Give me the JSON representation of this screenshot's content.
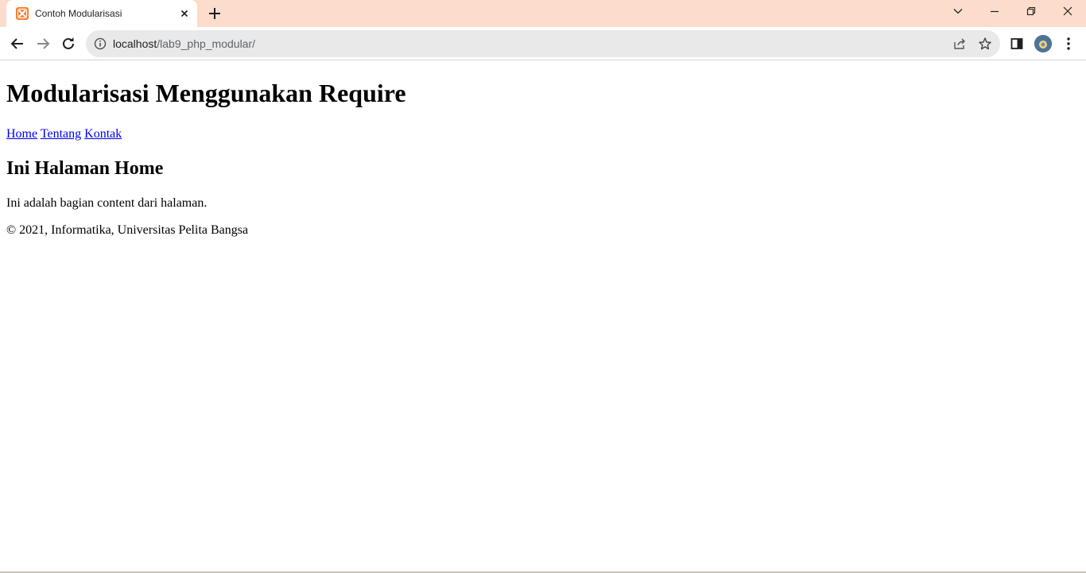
{
  "browser": {
    "tab": {
      "title": "Contoh Modularisasi",
      "favicon": "xampp-icon"
    },
    "address": {
      "host": "localhost",
      "path": "/lab9_php_modular/"
    },
    "colors": {
      "tabstrip": "#fcdcca",
      "omnibox": "#e9e9e9",
      "favicon": "#fb7a24"
    }
  },
  "page": {
    "title": "Modularisasi Menggunakan Require",
    "nav": [
      {
        "label": "Home"
      },
      {
        "label": "Tentang"
      },
      {
        "label": "Kontak"
      }
    ],
    "heading": "Ini Halaman Home",
    "body": "Ini adalah bagian content dari halaman.",
    "footer": "© 2021, Informatika, Universitas Pelita Bangsa",
    "link_color": "#0000ee"
  }
}
